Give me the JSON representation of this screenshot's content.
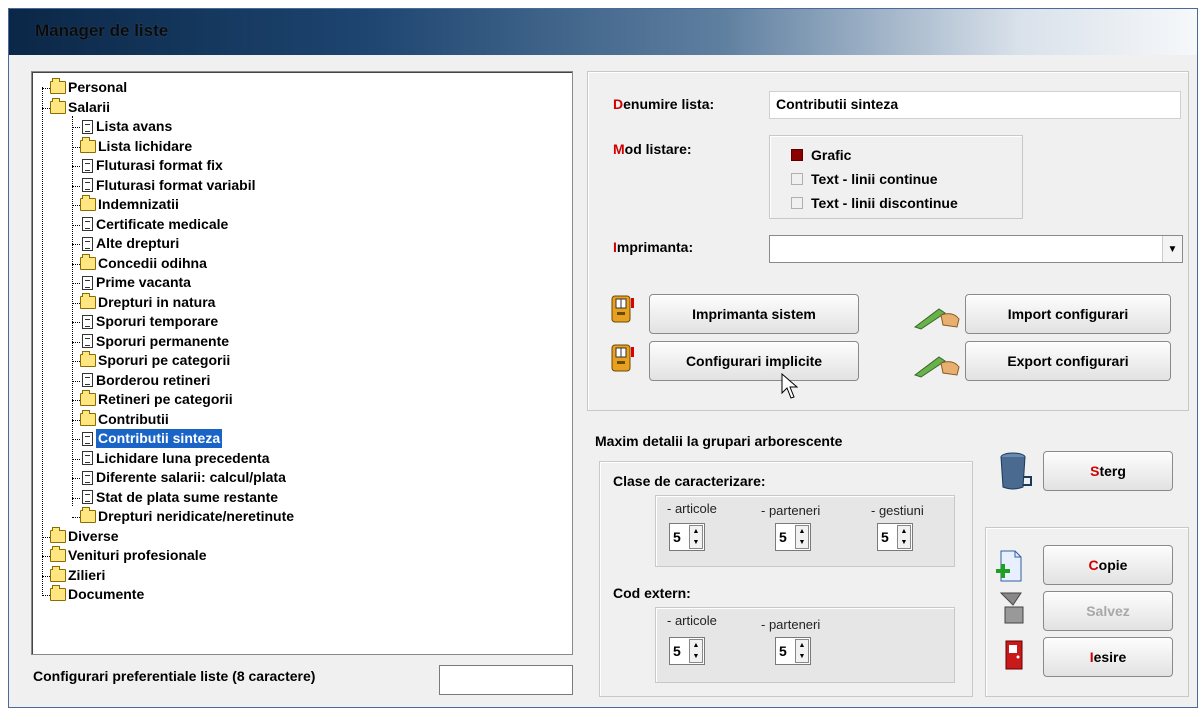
{
  "window": {
    "title": "Manager de liste"
  },
  "tree": {
    "items": [
      {
        "label": "Personal",
        "type": "folder",
        "level": 0
      },
      {
        "label": "Salarii",
        "type": "folder-open",
        "level": 0
      },
      {
        "label": "Lista avans",
        "type": "doc",
        "level": 1
      },
      {
        "label": "Lista lichidare",
        "type": "folder",
        "level": 1
      },
      {
        "label": "Fluturasi format fix",
        "type": "doc",
        "level": 1
      },
      {
        "label": "Fluturasi format variabil",
        "type": "doc",
        "level": 1
      },
      {
        "label": "Indemnizatii",
        "type": "folder",
        "level": 1
      },
      {
        "label": "Certificate medicale",
        "type": "doc",
        "level": 1
      },
      {
        "label": "Alte drepturi",
        "type": "doc",
        "level": 1
      },
      {
        "label": "Concedii odihna",
        "type": "folder",
        "level": 1
      },
      {
        "label": "Prime vacanta",
        "type": "doc",
        "level": 1
      },
      {
        "label": "Drepturi in natura",
        "type": "folder",
        "level": 1
      },
      {
        "label": "Sporuri temporare",
        "type": "doc",
        "level": 1
      },
      {
        "label": "Sporuri permanente",
        "type": "doc",
        "level": 1
      },
      {
        "label": "Sporuri pe categorii",
        "type": "folder",
        "level": 1
      },
      {
        "label": "Borderou retineri",
        "type": "doc",
        "level": 1
      },
      {
        "label": "Retineri pe categorii",
        "type": "folder",
        "level": 1
      },
      {
        "label": "Contributii",
        "type": "folder",
        "level": 1
      },
      {
        "label": "Contributii sinteza",
        "type": "doc",
        "level": 1,
        "selected": true
      },
      {
        "label": "Lichidare luna precedenta",
        "type": "doc",
        "level": 1
      },
      {
        "label": "Diferente salarii: calcul/plata",
        "type": "doc",
        "level": 1
      },
      {
        "label": "Stat de plata sume restante",
        "type": "doc",
        "level": 1
      },
      {
        "label": "Drepturi neridicate/neretinute",
        "type": "folder",
        "level": 1
      },
      {
        "label": "Diverse",
        "type": "folder",
        "level": 0
      },
      {
        "label": "Venituri profesionale",
        "type": "folder",
        "level": 0
      },
      {
        "label": "Zilieri",
        "type": "folder",
        "level": 0
      },
      {
        "label": "Documente",
        "type": "folder",
        "level": 0
      }
    ]
  },
  "preferences": {
    "label": "Configurari preferentiale liste (8 caractere)",
    "value": ""
  },
  "details": {
    "name_label_first": "D",
    "name_label_rest": "enumire lista:",
    "name_value": "Contributii sinteza",
    "mode_label_first": "M",
    "mode_label_rest": "od listare:",
    "modes": [
      {
        "label": "Grafic",
        "selected": true
      },
      {
        "label": "Text - linii continue",
        "selected": false
      },
      {
        "label": "Text - linii discontinue",
        "selected": false
      }
    ],
    "printer_label_first": "I",
    "printer_label_rest": "mprimanta:",
    "printer_value": ""
  },
  "buttons": {
    "system_printer": "Imprimanta sistem",
    "default_config": "Configurari implicite",
    "import_config": "Import configurari",
    "export_config": "Export configurari",
    "delete_first": "S",
    "delete_rest": "terg",
    "copy_first": "C",
    "copy_rest": "opie",
    "save": "Salvez",
    "exit_first": "I",
    "exit_rest": "esire"
  },
  "grouping": {
    "title": "Maxim detalii la grupari arborescente",
    "class_title": "Clase de caracterizare:",
    "class_fields": [
      {
        "label": "- articole",
        "value": "5"
      },
      {
        "label": "- parteneri",
        "value": "5"
      },
      {
        "label": "- gestiuni",
        "value": "5"
      }
    ],
    "code_title": "Cod extern:",
    "code_fields": [
      {
        "label": "- articole",
        "value": "5"
      },
      {
        "label": "- parteneri",
        "value": "5"
      }
    ]
  },
  "colors": {
    "accent": "#d00000",
    "selection": "#1a64c8",
    "radio_on": "#8b0000"
  }
}
